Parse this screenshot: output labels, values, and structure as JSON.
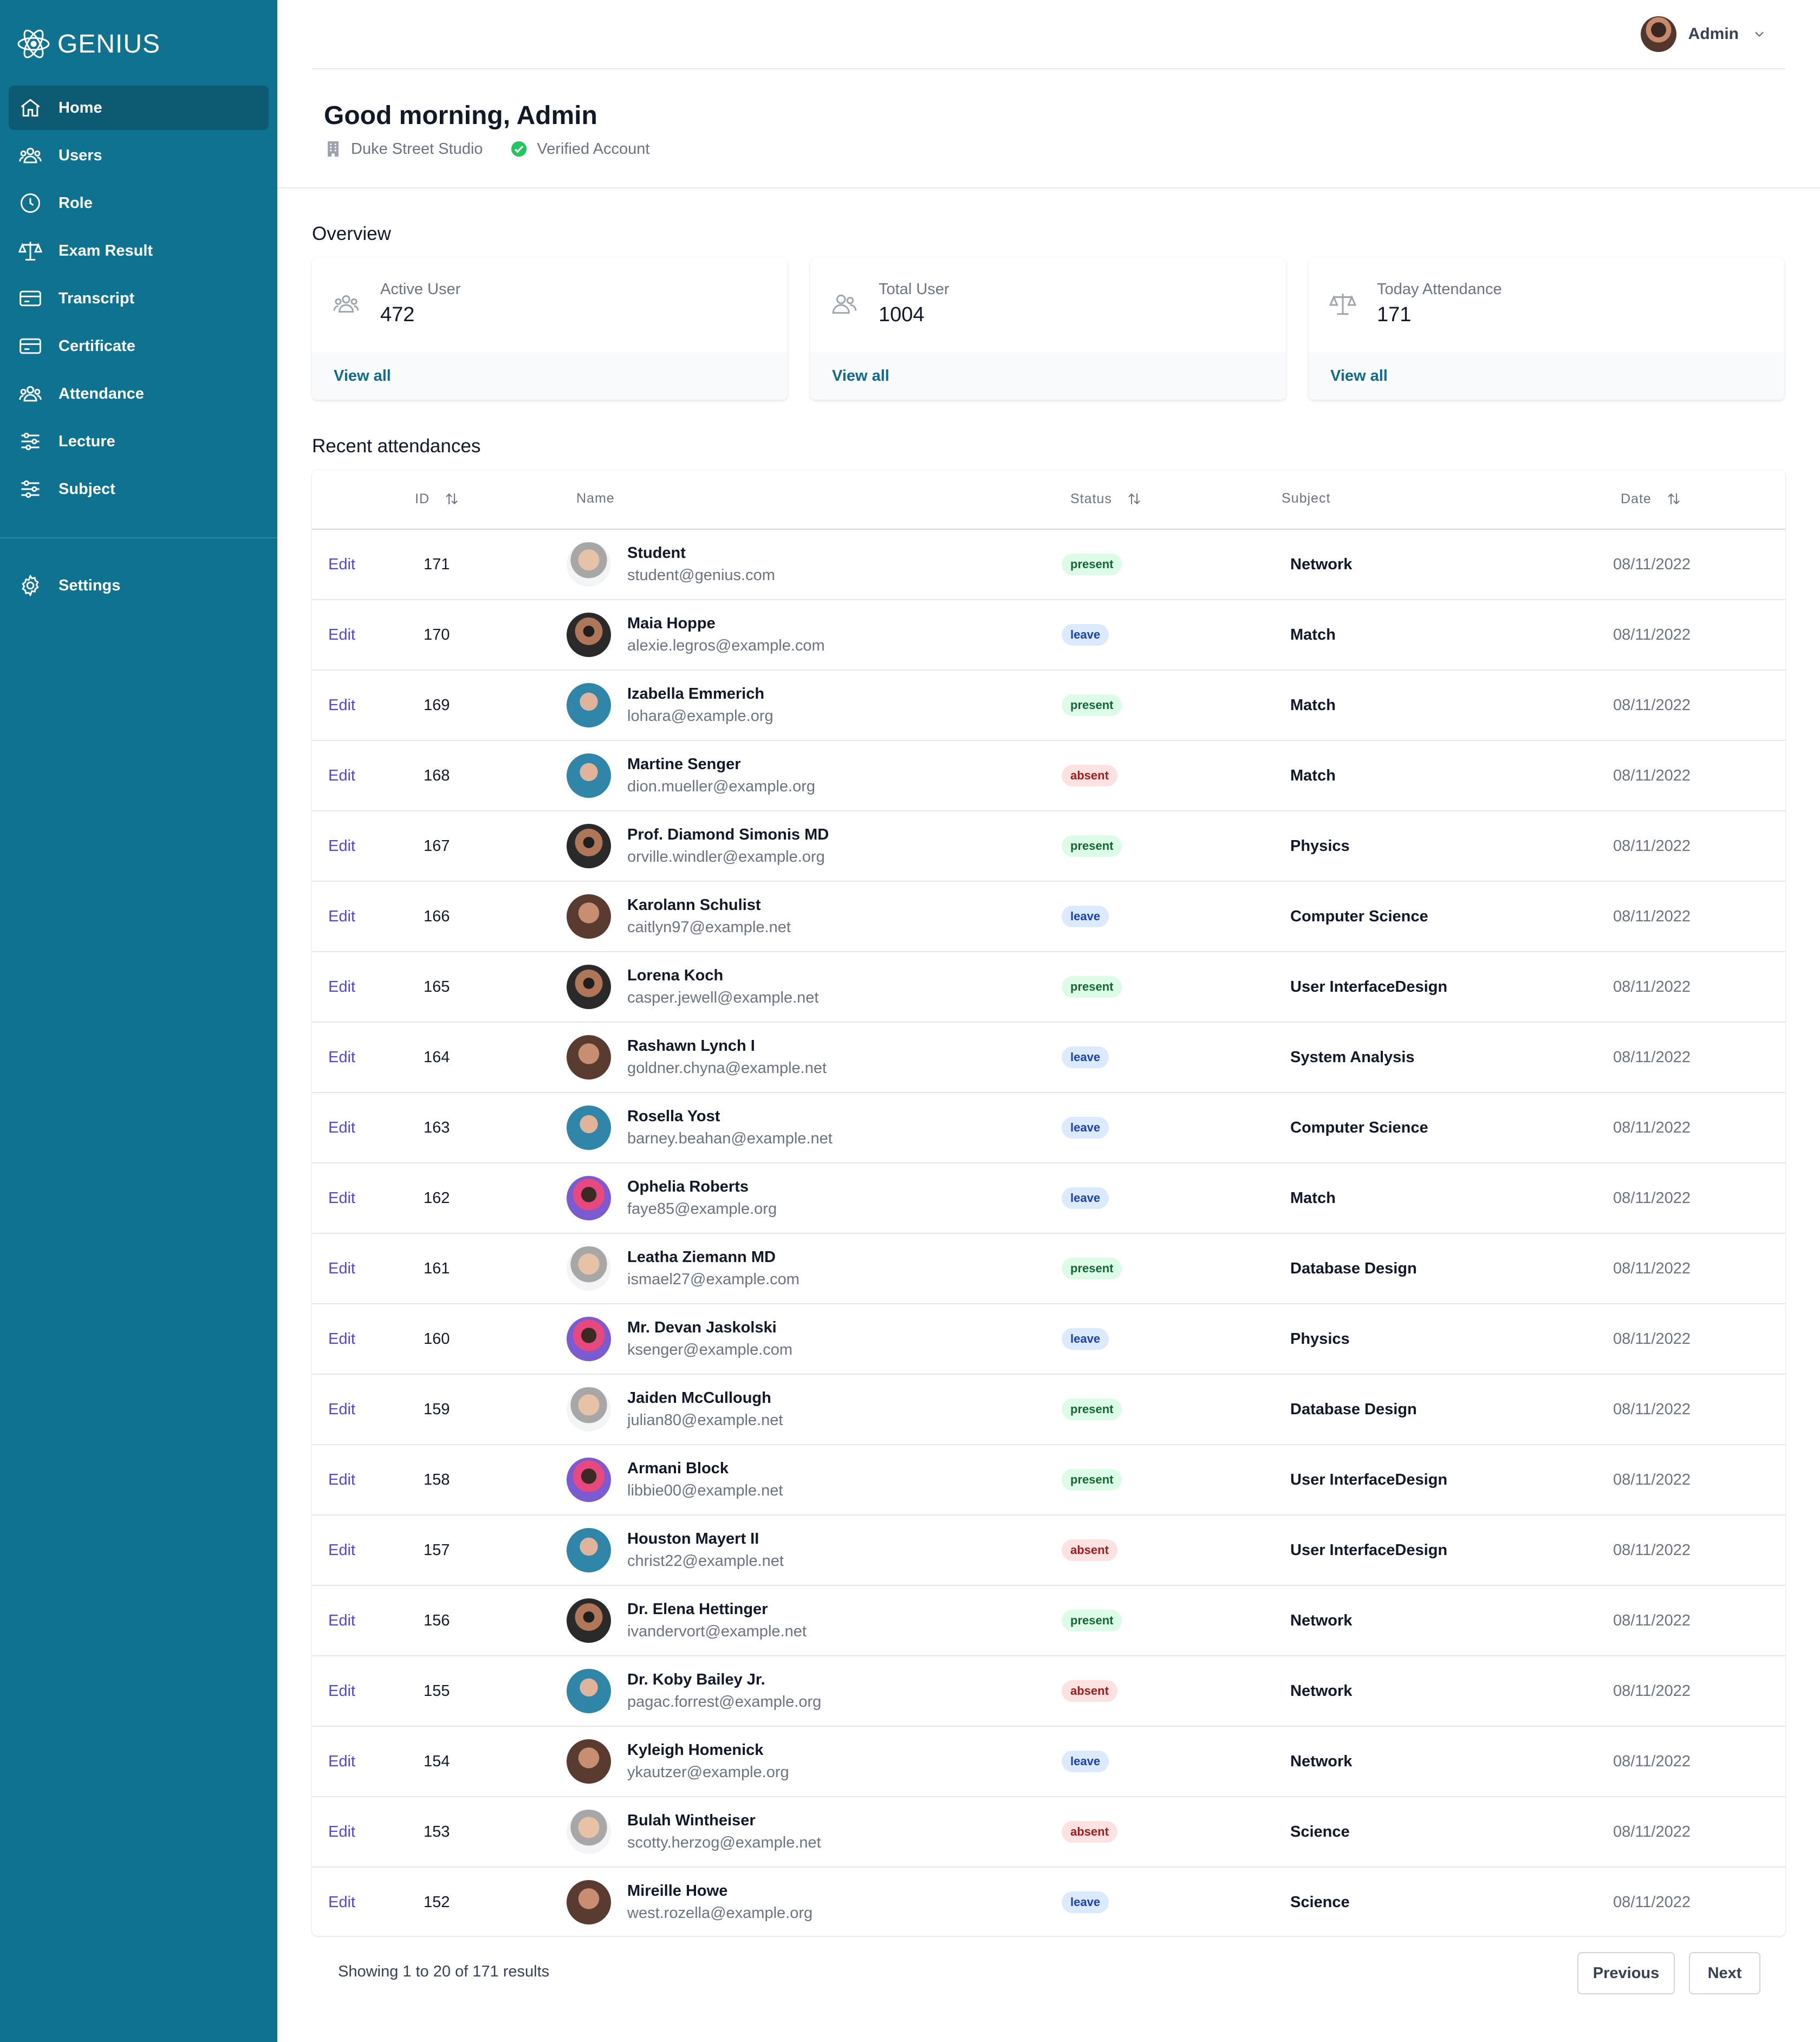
{
  "app": {
    "brand": "GENIUS"
  },
  "sidebar": {
    "items": [
      {
        "label": "Home",
        "icon": "home-icon",
        "active": true
      },
      {
        "label": "Users",
        "icon": "users-icon"
      },
      {
        "label": "Role",
        "icon": "clock-icon"
      },
      {
        "label": "Exam Result",
        "icon": "scale-icon"
      },
      {
        "label": "Transcript",
        "icon": "card-icon"
      },
      {
        "label": "Certificate",
        "icon": "card-icon"
      },
      {
        "label": "Attendance",
        "icon": "users-icon"
      },
      {
        "label": "Lecture",
        "icon": "sliders-icon"
      },
      {
        "label": "Subject",
        "icon": "sliders-icon"
      }
    ],
    "settings": {
      "label": "Settings",
      "icon": "gear-icon"
    }
  },
  "header": {
    "user": "Admin",
    "greeting": "Good morning, Admin",
    "org": "Duke Street Studio",
    "verified": "Verified Account"
  },
  "overview": {
    "title": "Overview",
    "cards": [
      {
        "label": "Active User",
        "value": "472",
        "link": "View all",
        "icon": "users-icon"
      },
      {
        "label": "Total User",
        "value": "1004",
        "link": "View all",
        "icon": "user-group-icon"
      },
      {
        "label": "Today Attendance",
        "value": "171",
        "link": "View all",
        "icon": "scale-icon"
      }
    ]
  },
  "attendance": {
    "title": "Recent attendances",
    "columns": {
      "id": "ID",
      "name": "Name",
      "status": "Status",
      "subject": "Subject",
      "date": "Date"
    },
    "edit_label": "Edit",
    "rows": [
      {
        "id": "171",
        "name": "Student",
        "email": "student@genius.com",
        "status": "present",
        "subject": "Network",
        "date": "08/11/2022"
      },
      {
        "id": "170",
        "name": "Maia Hoppe",
        "email": "alexie.legros@example.com",
        "status": "leave",
        "subject": "Match",
        "date": "08/11/2022"
      },
      {
        "id": "169",
        "name": "Izabella Emmerich",
        "email": "lohara@example.org",
        "status": "present",
        "subject": "Match",
        "date": "08/11/2022"
      },
      {
        "id": "168",
        "name": "Martine Senger",
        "email": "dion.mueller@example.org",
        "status": "absent",
        "subject": "Match",
        "date": "08/11/2022"
      },
      {
        "id": "167",
        "name": "Prof. Diamond Simonis MD",
        "email": "orville.windler@example.org",
        "status": "present",
        "subject": "Physics",
        "date": "08/11/2022"
      },
      {
        "id": "166",
        "name": "Karolann Schulist",
        "email": "caitlyn97@example.net",
        "status": "leave",
        "subject": "Computer Science",
        "date": "08/11/2022"
      },
      {
        "id": "165",
        "name": "Lorena Koch",
        "email": "casper.jewell@example.net",
        "status": "present",
        "subject": "User InterfaceDesign",
        "date": "08/11/2022"
      },
      {
        "id": "164",
        "name": "Rashawn Lynch I",
        "email": "goldner.chyna@example.net",
        "status": "leave",
        "subject": "System Analysis",
        "date": "08/11/2022"
      },
      {
        "id": "163",
        "name": "Rosella Yost",
        "email": "barney.beahan@example.net",
        "status": "leave",
        "subject": "Computer Science",
        "date": "08/11/2022"
      },
      {
        "id": "162",
        "name": "Ophelia Roberts",
        "email": "faye85@example.org",
        "status": "leave",
        "subject": "Match",
        "date": "08/11/2022"
      },
      {
        "id": "161",
        "name": "Leatha Ziemann MD",
        "email": "ismael27@example.com",
        "status": "present",
        "subject": "Database Design",
        "date": "08/11/2022"
      },
      {
        "id": "160",
        "name": "Mr. Devan Jaskolski",
        "email": "ksenger@example.com",
        "status": "leave",
        "subject": "Physics",
        "date": "08/11/2022"
      },
      {
        "id": "159",
        "name": "Jaiden McCullough",
        "email": "julian80@example.net",
        "status": "present",
        "subject": "Database Design",
        "date": "08/11/2022"
      },
      {
        "id": "158",
        "name": "Armani Block",
        "email": "libbie00@example.net",
        "status": "present",
        "subject": "User InterfaceDesign",
        "date": "08/11/2022"
      },
      {
        "id": "157",
        "name": "Houston Mayert II",
        "email": "christ22@example.net",
        "status": "absent",
        "subject": "User InterfaceDesign",
        "date": "08/11/2022"
      },
      {
        "id": "156",
        "name": "Dr. Elena Hettinger",
        "email": "ivandervort@example.net",
        "status": "present",
        "subject": "Network",
        "date": "08/11/2022"
      },
      {
        "id": "155",
        "name": "Dr. Koby Bailey Jr.",
        "email": "pagac.forrest@example.org",
        "status": "absent",
        "subject": "Network",
        "date": "08/11/2022"
      },
      {
        "id": "154",
        "name": "Kyleigh Homenick",
        "email": "ykautzer@example.org",
        "status": "leave",
        "subject": "Network",
        "date": "08/11/2022"
      },
      {
        "id": "153",
        "name": "Bulah Wintheiser",
        "email": "scotty.herzog@example.net",
        "status": "absent",
        "subject": "Science",
        "date": "08/11/2022"
      },
      {
        "id": "152",
        "name": "Mireille Howe",
        "email": "west.rozella@example.org",
        "status": "leave",
        "subject": "Science",
        "date": "08/11/2022"
      }
    ]
  },
  "pagination": {
    "summary": "Showing 1 to 20 of 171 results",
    "previous": "Previous",
    "next": "Next"
  },
  "colors": {
    "sidebar": "#0f7290",
    "sidebar_active": "#0d5a73",
    "link": "#4f46e5",
    "present": "#dcfce7",
    "leave": "#dbeafe",
    "absent": "#fee2e2"
  }
}
